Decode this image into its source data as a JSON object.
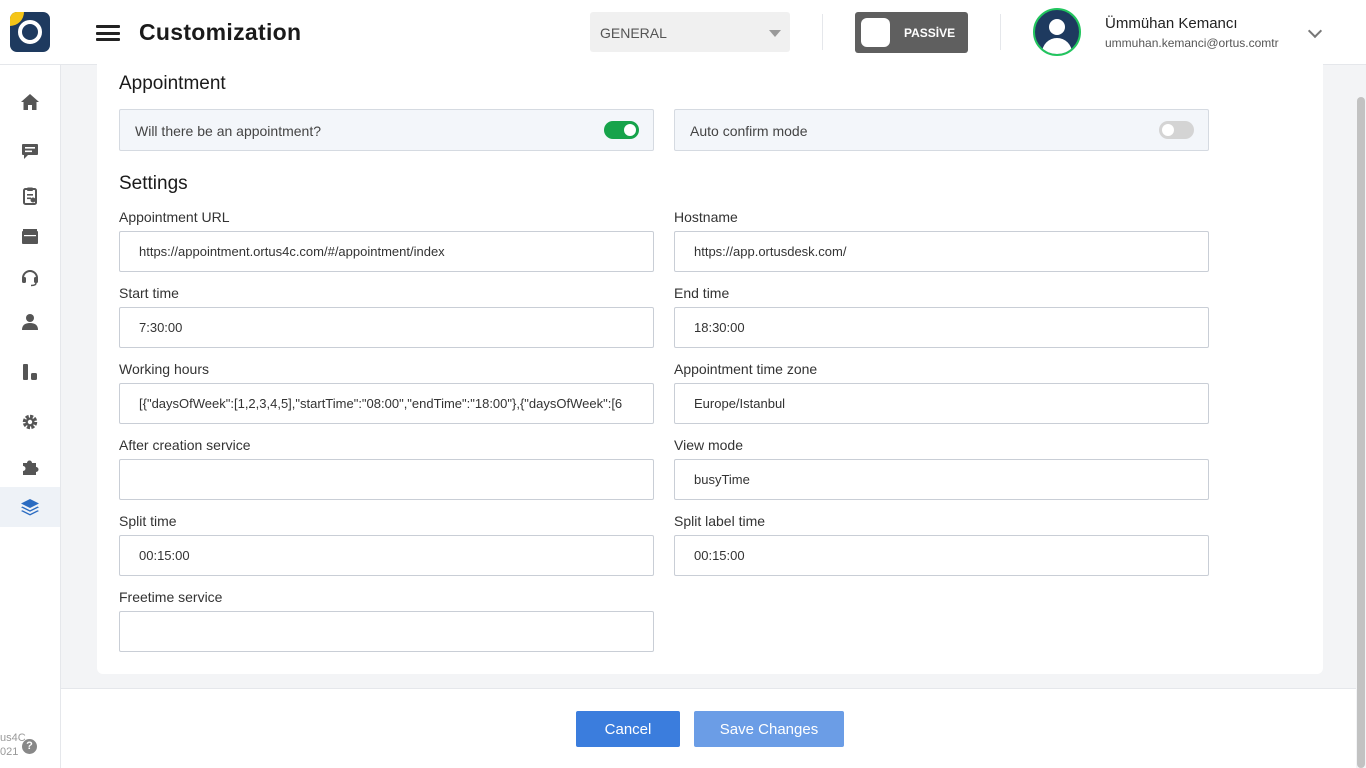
{
  "header": {
    "title": "Customization",
    "group_select": "GENERAL",
    "status_toggle": "PASSİVE",
    "user_name": "Ümmühan Kemancı",
    "user_email": "ummuhan.kemanci@ortus.comtr"
  },
  "sidebar": {
    "items": [
      "home-icon",
      "chat-icon",
      "clipboard-icon",
      "folder-icon",
      "headset-icon",
      "user-icon",
      "chart-icon",
      "gear-icon",
      "puzzle-icon",
      "layers-icon"
    ],
    "active": "layers-icon",
    "footer_line1": "us4C",
    "footer_line2": "021"
  },
  "appointment": {
    "title": "Appointment",
    "will_have_appointment_label": "Will there be an appointment?",
    "will_have_appointment": true,
    "auto_confirm_label": "Auto confirm mode",
    "auto_confirm": false
  },
  "settings": {
    "title": "Settings",
    "appointment_url": {
      "label": "Appointment URL",
      "value": "https://appointment.ortus4c.com/#/appointment/index"
    },
    "hostname": {
      "label": "Hostname",
      "value": "https://app.ortusdesk.com/"
    },
    "start_time": {
      "label": "Start time",
      "value": "7:30:00"
    },
    "end_time": {
      "label": "End time",
      "value": "18:30:00"
    },
    "working_hours": {
      "label": "Working hours",
      "value": "[{\"daysOfWeek\":[1,2,3,4,5],\"startTime\":\"08:00\",\"endTime\":\"18:00\"},{\"daysOfWeek\":[6"
    },
    "time_zone": {
      "label": "Appointment time zone",
      "value": "Europe/Istanbul"
    },
    "after_creation_service": {
      "label": "After creation service",
      "value": ""
    },
    "view_mode": {
      "label": "View mode",
      "value": "busyTime"
    },
    "split_time": {
      "label": "Split time",
      "value": "00:15:00"
    },
    "split_label_time": {
      "label": "Split label time",
      "value": "00:15:00"
    },
    "freetime_service": {
      "label": "Freetime service",
      "value": ""
    }
  },
  "footer": {
    "cancel_label": "Cancel",
    "save_label": "Save Changes"
  },
  "colors": {
    "brand_navy": "#1e3a5f",
    "brand_yellow": "#f5c518",
    "toggle_on": "#16a34a",
    "primary_button": "#3b7ddd"
  }
}
